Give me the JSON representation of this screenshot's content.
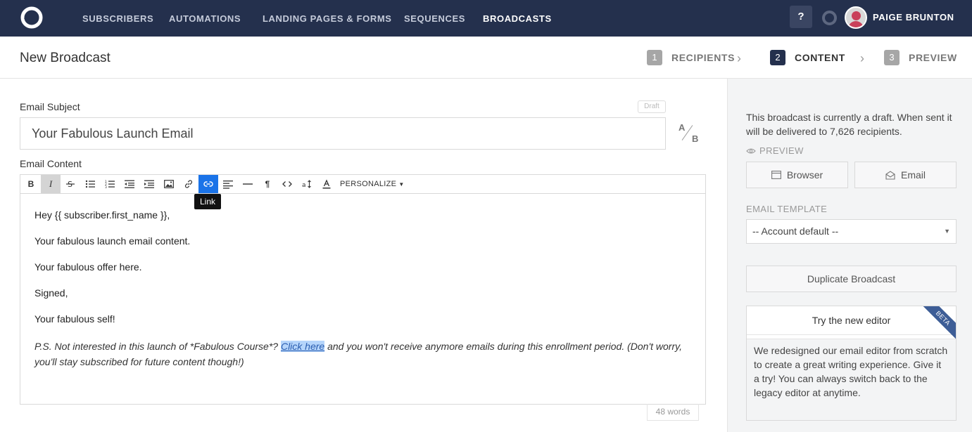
{
  "nav": {
    "items": [
      "SUBSCRIBERS",
      "AUTOMATIONS",
      "LANDING PAGES & FORMS",
      "SEQUENCES",
      "BROADCASTS"
    ],
    "help_label": "?",
    "user_name": "PAIGE BRUNTON"
  },
  "header": {
    "title": "New Broadcast",
    "steps": [
      {
        "num": "1",
        "label": "RECIPIENTS"
      },
      {
        "num": "2",
        "label": "CONTENT"
      },
      {
        "num": "3",
        "label": "PREVIEW"
      }
    ],
    "active_step": "CONTENT"
  },
  "main": {
    "subject_label": "Email Subject",
    "draft_badge": "Draft",
    "subject_value": "Your Fabulous Launch Email",
    "ab_a": "A",
    "ab_b": "B",
    "content_label": "Email Content",
    "toolbar": {
      "bold": "B",
      "italic": "I",
      "personalize": "PERSONALIZE",
      "tooltip": "Link"
    },
    "editor": {
      "line1": "Hey {{ subscriber.first_name }},",
      "line2": "Your fabulous launch email content.",
      "line3": "Your fabulous offer here.",
      "line4": "Signed,",
      "line5": "Your fabulous self!",
      "ps_before": "P.S. Not interested in this launch of *Fabulous Course*? ",
      "ps_link": "Click here",
      "ps_after": " and you won't receive anymore emails during this enrollment period. (Don't worry, you'll stay subscribed for future content though!)"
    },
    "word_count": "48 words"
  },
  "sidebar": {
    "draft_info": "This broadcast is currently a draft. When sent it will be delivered to 7,626 recipients.",
    "preview_label": "PREVIEW",
    "browser_button": "Browser",
    "email_button": "Email",
    "template_label": "EMAIL TEMPLATE",
    "template_value": "-- Account default --",
    "duplicate_button": "Duplicate Broadcast",
    "new_editor_title": "Try the new editor",
    "new_editor_body": "We redesigned our email editor from scratch to create a great writing experience. Give it a try! You can always switch back to the legacy editor at anytime.",
    "beta_label": "BETA"
  },
  "colors": {
    "nav_bg": "#24304d",
    "link_highlight": "#1a73e8",
    "beta_ribbon": "#3d5d96"
  }
}
